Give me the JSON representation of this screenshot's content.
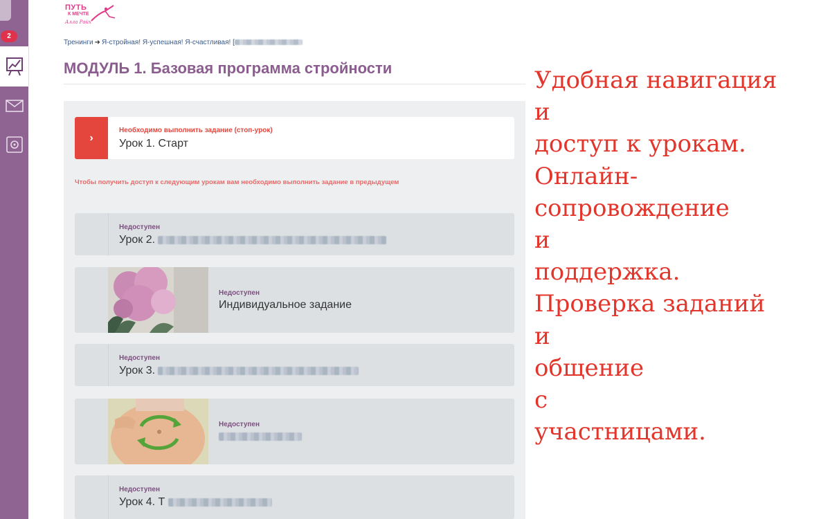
{
  "rail": {
    "badge_count": "2",
    "items": [
      {
        "name": "trainings",
        "icon": "chart-board-icon",
        "active": true
      },
      {
        "name": "messages",
        "icon": "envelope-icon"
      },
      {
        "name": "safe",
        "icon": "safe-icon"
      }
    ]
  },
  "logo": {
    "line1": "ПУТЬ",
    "line2": "К МЕЧТЕ",
    "line3": "Алла Райх"
  },
  "breadcrumb": {
    "root": "Тренинги",
    "arrow": "➜",
    "course": "Я-стройная! Я-успешная! Я-счастливая!",
    "rest_prefix": "["
  },
  "page_title": "МОДУЛЬ 1. Базовая программа стройности",
  "lessons": {
    "current": {
      "status": "Необходимо выполнить задание (стоп-урок)",
      "title": "Урок 1. Старт",
      "arrow": "›"
    },
    "notice": "Чтобы получить доступ к следующим урокам вам необходимо выполнить задание  в предыдущем",
    "items": [
      {
        "status": "Недоступен",
        "title": "Урок 2."
      },
      {
        "status": "Недоступен",
        "title": "Индивидуальное задание"
      },
      {
        "status": "Недоступен",
        "title": "Урок 3."
      },
      {
        "status": "Недоступен",
        "title": ""
      },
      {
        "status": "Недоступен",
        "title": "Урок 4. Т"
      }
    ]
  },
  "promo": {
    "lines": [
      "Удобная навигация",
      "и",
      "доступ к урокам.",
      "Онлайн-",
      "сопровождение",
      "и",
      "поддержка.",
      "Проверка заданий",
      "и",
      "общение",
      "с",
      "участницами."
    ]
  },
  "colors": {
    "rail": "#8f6392",
    "accent_red": "#e4463d",
    "title_purple": "#8b5d8e",
    "promo_red": "#e2352b"
  }
}
